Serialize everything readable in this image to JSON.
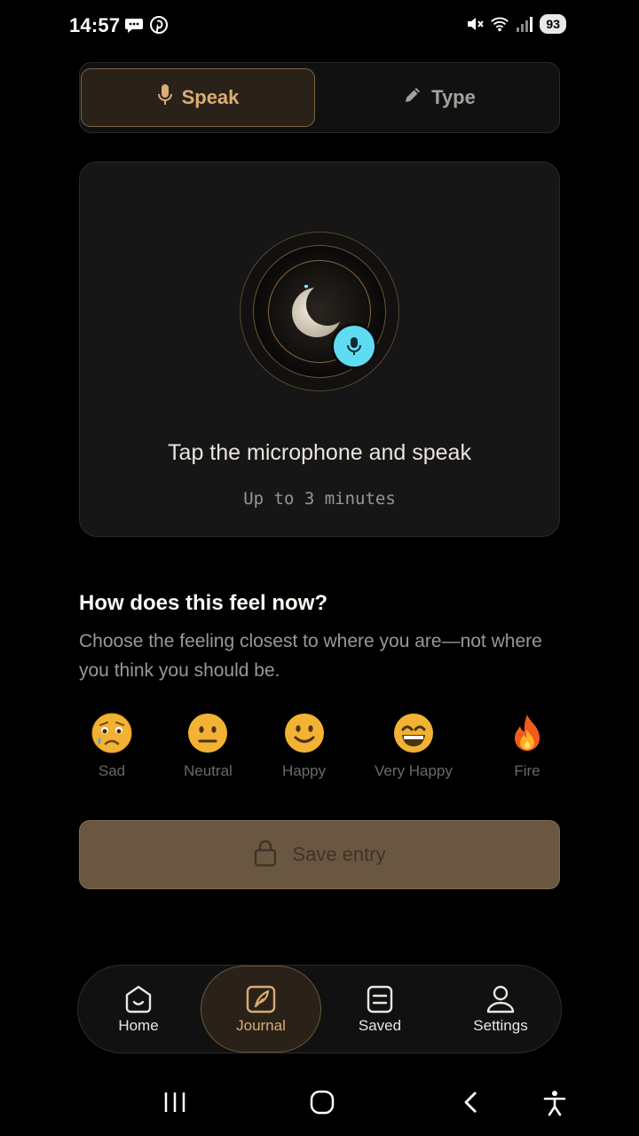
{
  "status_bar": {
    "time": "14:57",
    "left_icons": [
      "chat-bubble-icon",
      "pinterest-icon"
    ],
    "right_icons": [
      "mute-icon",
      "wifi-icon",
      "signal-icon"
    ],
    "battery": "93"
  },
  "mode_toggle": {
    "options": [
      {
        "label": "Speak",
        "icon": "mic-icon",
        "selected": true
      },
      {
        "label": "Type",
        "icon": "pencil-icon",
        "selected": false
      }
    ]
  },
  "voice_card": {
    "title": "Tap the microphone and speak",
    "subtitle": "Up to 3 minutes",
    "mic_color": "#5fdcf2"
  },
  "mood": {
    "title": "How does this feel now?",
    "description": "Choose the feeling closest to where you are—not where you think you should be.",
    "options": [
      {
        "label": "Sad",
        "icon": "crying-face-icon"
      },
      {
        "label": "Neutral",
        "icon": "neutral-face-icon"
      },
      {
        "label": "Happy",
        "icon": "smiling-face-icon"
      },
      {
        "label": "Very Happy",
        "icon": "grinning-face-icon"
      },
      {
        "label": "Fire",
        "icon": "fire-icon"
      }
    ]
  },
  "save_button": {
    "label": "Save entry",
    "icon": "lock-icon"
  },
  "bottom_nav": {
    "items": [
      {
        "label": "Home",
        "icon": "home-icon",
        "active": false
      },
      {
        "label": "Journal",
        "icon": "journal-icon",
        "active": true
      },
      {
        "label": "Saved",
        "icon": "saved-icon",
        "active": false
      },
      {
        "label": "Settings",
        "icon": "person-icon",
        "active": false
      }
    ]
  },
  "colors": {
    "accent": "#d9ad75",
    "background": "#000000",
    "card": "#161616",
    "save_button": "#6a5741"
  }
}
